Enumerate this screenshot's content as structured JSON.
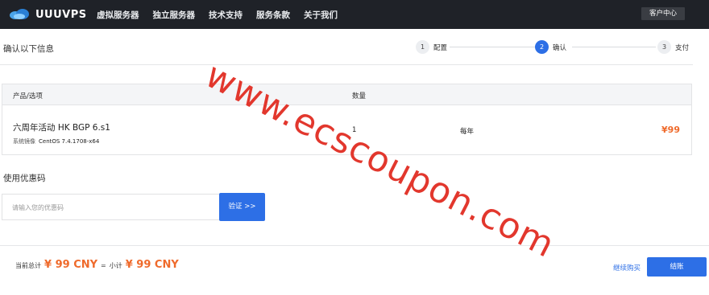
{
  "brand": {
    "name": "UUUVPS"
  },
  "nav": {
    "items": [
      "虚拟服务器",
      "独立服务器",
      "技术支持",
      "服务条款",
      "关于我们"
    ],
    "client_center": "客户中心"
  },
  "page": {
    "title": "确认以下信息"
  },
  "steps": [
    {
      "num": "1",
      "label": "配置",
      "active": false
    },
    {
      "num": "2",
      "label": "确认",
      "active": true
    },
    {
      "num": "3",
      "label": "支付",
      "active": false
    }
  ],
  "table": {
    "headers": {
      "product": "产品/选项",
      "qty": "数量"
    },
    "row": {
      "name": "六周年活动 HK BGP 6.s1",
      "os_label": "系统镜像",
      "os_value": "CentOS 7.4.1708-x64",
      "qty": "1",
      "cycle": "每年",
      "price": "¥99"
    }
  },
  "coupon": {
    "title": "使用优惠码",
    "placeholder": "请输入您的优惠码",
    "button": "验证 >>"
  },
  "summary": {
    "label_current": "当前总计",
    "total": "¥ 99 CNY",
    "eq": "=",
    "label_subtotal": "小计",
    "subtotal": "¥ 99 CNY",
    "continue": "继续购买",
    "checkout": "结账"
  },
  "watermark": "www.ecscoupon.com",
  "colors": {
    "accent": "#2d6fe6",
    "price": "#ef6a2b",
    "topbar": "#1f2228",
    "watermark": "#e2372d"
  }
}
